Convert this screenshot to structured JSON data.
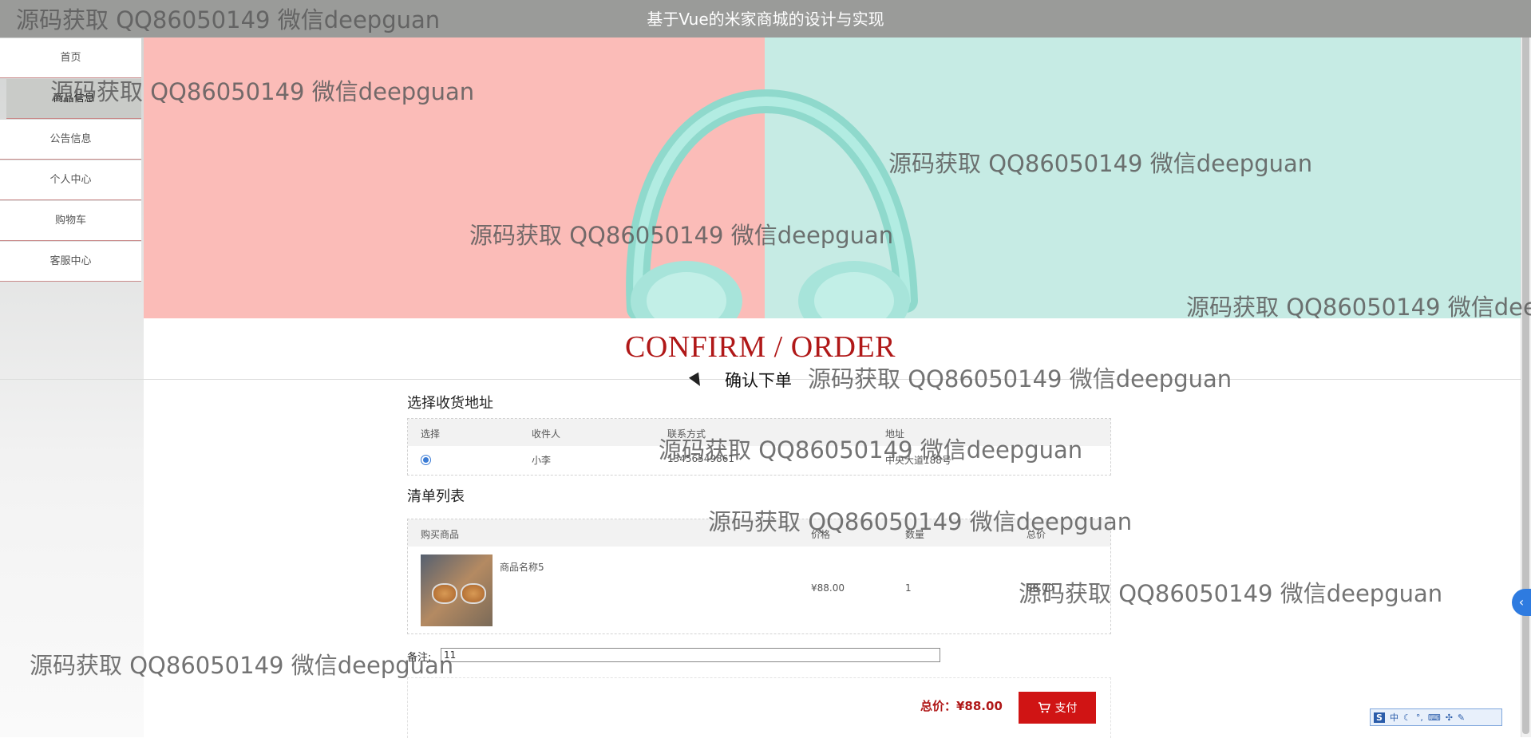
{
  "header": {
    "title": "基于Vue的米家商城的设计与实现"
  },
  "sidebar": {
    "items": [
      {
        "label": "首页"
      },
      {
        "label": "商品信息"
      },
      {
        "label": "公告信息"
      },
      {
        "label": "个人中心"
      },
      {
        "label": "购物车"
      },
      {
        "label": "客服中心"
      }
    ],
    "active_index": 1
  },
  "page": {
    "title_en": "CONFIRM / ORDER",
    "title_cn": "确认下单"
  },
  "address_section": {
    "title": "选择收货地址",
    "columns": [
      "选择",
      "收件人",
      "联系方式",
      "地址"
    ],
    "rows": [
      {
        "selected": true,
        "recipient": "小李",
        "phone": "13456549861",
        "address": "中央大道188号"
      }
    ]
  },
  "order_section": {
    "title": "清单列表",
    "columns": [
      "购买商品",
      "价格",
      "数量",
      "总价"
    ],
    "items": [
      {
        "name": "商品名称5",
        "price": "¥88.00",
        "quantity": "1",
        "total": "88.00"
      }
    ]
  },
  "remark": {
    "label": "备注:",
    "value": "11"
  },
  "payment": {
    "total_label": "总价：¥88.00",
    "pay_button": "支付"
  },
  "watermark_text": "源码获取 QQ86050149 微信deepguan",
  "ime": {
    "label": "中"
  },
  "colors": {
    "accent": "#d01414",
    "title_red": "#b01818",
    "banner_left": "#fbbcb8",
    "banner_right": "#c6ebe4"
  }
}
